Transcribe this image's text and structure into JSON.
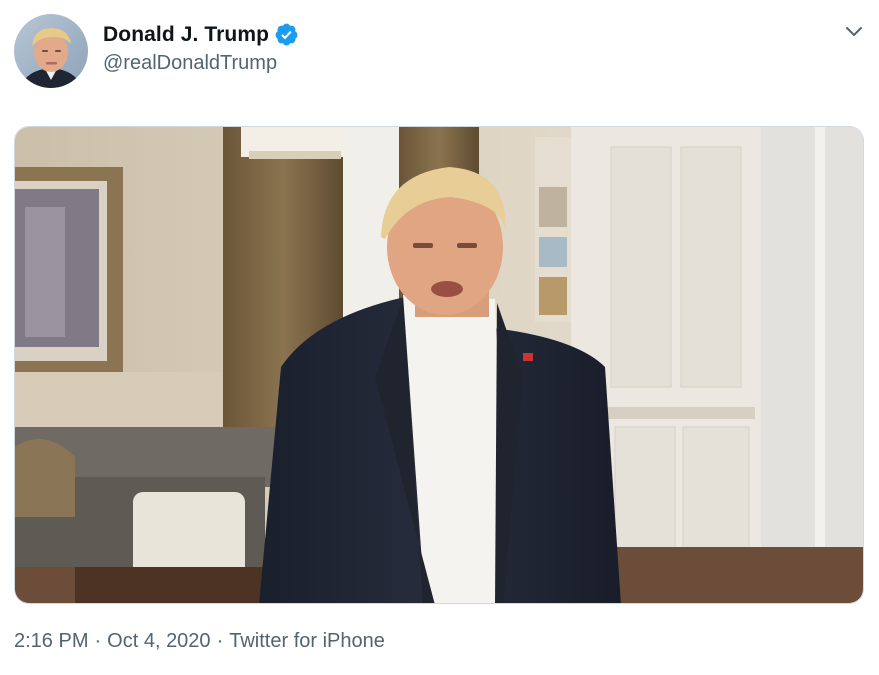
{
  "author": {
    "display_name": "Donald J. Trump",
    "handle": "@realDonaldTrump",
    "verified_icon": "verified-badge-icon",
    "avatar_icon": "profile-photo"
  },
  "menu": {
    "icon": "chevron-down-icon"
  },
  "media": {
    "type": "video",
    "icon": "video-frame"
  },
  "meta": {
    "time": "2:16 PM",
    "separator": "·",
    "date": "Oct 4, 2020",
    "source": "Twitter for iPhone"
  },
  "colors": {
    "verified_blue": "#1d9bf0",
    "secondary_text": "#536471",
    "primary_text": "#0f1419"
  }
}
